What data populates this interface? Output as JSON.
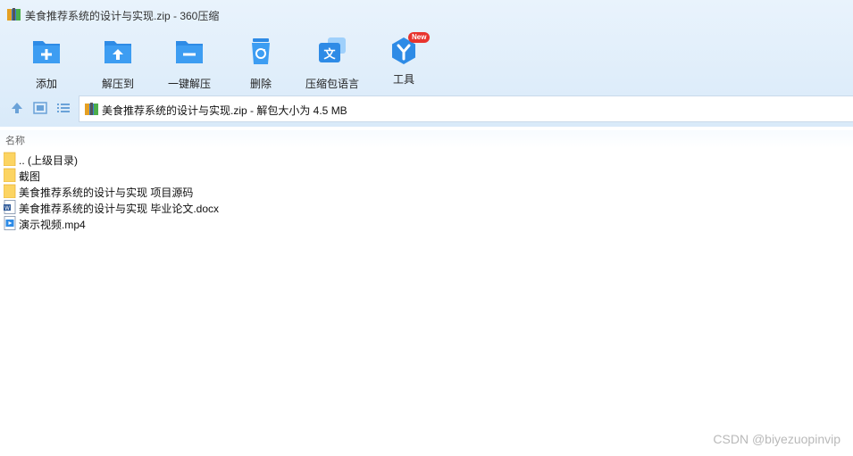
{
  "window": {
    "title": "美食推荐系统的设计与实现.zip - 360压缩"
  },
  "toolbar": {
    "items": [
      {
        "label": "添加",
        "icon": "add-folder-icon"
      },
      {
        "label": "解压到",
        "icon": "extract-to-icon"
      },
      {
        "label": "一键解压",
        "icon": "one-click-extract-icon"
      },
      {
        "label": "删除",
        "icon": "recycle-bin-icon"
      },
      {
        "label": "压缩包语言",
        "icon": "language-icon"
      },
      {
        "label": "工具",
        "icon": "tools-icon",
        "badge": "New"
      }
    ]
  },
  "address": {
    "path": "美食推荐系统的设计与实现.zip - 解包大小为 4.5 MB"
  },
  "columns": {
    "name": "名称"
  },
  "files": [
    {
      "name": ".. (上级目录)",
      "type": "folder"
    },
    {
      "name": "截图",
      "type": "folder"
    },
    {
      "name": "美食推荐系统的设计与实现 项目源码",
      "type": "folder"
    },
    {
      "name": "美食推荐系统的设计与实现 毕业论文.docx",
      "type": "docx"
    },
    {
      "name": "演示视频.mp4",
      "type": "video"
    }
  ],
  "watermark": "CSDN @biyezuopinvip",
  "colors": {
    "accent": "#2e8be6",
    "badge": "#e8342e",
    "folder": "#fcd462"
  }
}
